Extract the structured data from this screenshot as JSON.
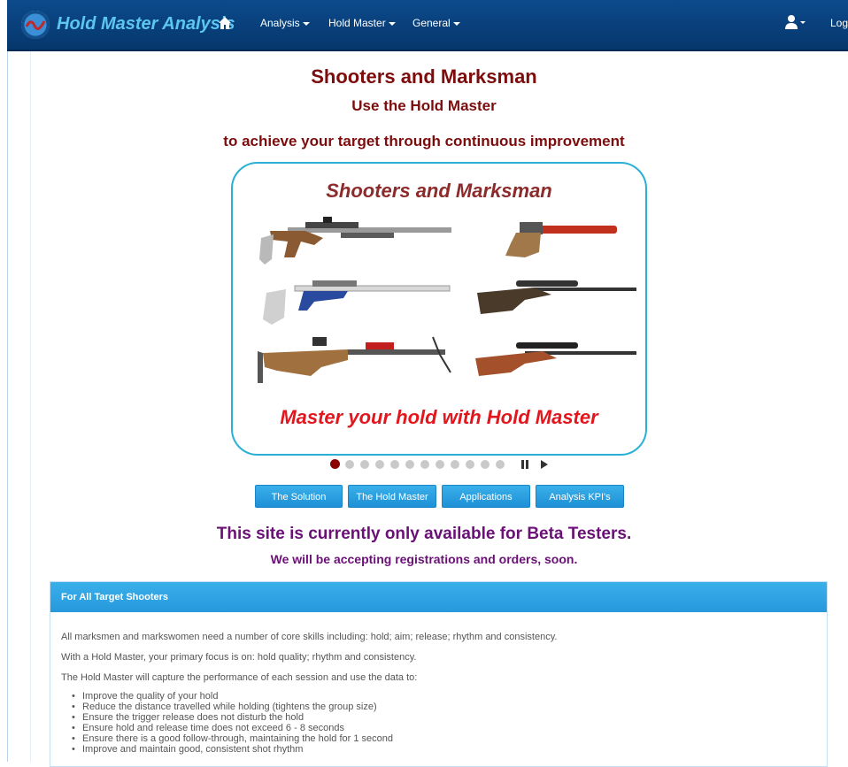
{
  "navbar": {
    "brand": "Hold Master Analysis",
    "items": [
      {
        "label": "Analysis"
      },
      {
        "label": "Hold Master"
      },
      {
        "label": "General"
      }
    ],
    "logout": "Log out"
  },
  "header": {
    "title": "Shooters and Marksman",
    "subtitle": "Use the Hold Master",
    "tagline": "to achieve your target through continuous improvement"
  },
  "carousel": {
    "slide_title": "Shooters and Marksman",
    "slide_caption": "Master your hold with Hold Master",
    "slide_count": 12,
    "active_index": 0
  },
  "buttons": [
    "The Solution",
    "The Hold Master",
    "Applications",
    "Analysis KPI's"
  ],
  "notice": {
    "headline": "This site is currently only available for Beta Testers.",
    "sub": "We will be accepting registrations and orders, soon."
  },
  "panel": {
    "title": "For All Target Shooters",
    "paragraphs": [
      "All marksmen and markswomen need a number of core skills including: hold; aim; release; rhythm and consistency.",
      "With a Hold Master, your primary focus is on: hold quality; rhythm and consistency.",
      "The Hold Master will capture the performance of each session and use the data to:"
    ],
    "bullets": [
      "Improve the quality of your hold",
      "Reduce the distance travelled while holding (tightens the group size)",
      "Ensure the trigger release does not disturb the hold",
      "Ensure hold and release time does not exceed 6 - 8 seconds",
      "Ensure there is a good follow-through, maintaining the hold for 1 second",
      "Improve and maintain good, consistent shot rhythm"
    ]
  },
  "colors": {
    "navbar": "#0c4a8c",
    "brand": "#5cc6f0",
    "headline": "#7d0c0c",
    "notice": "#6a1077",
    "button": "#1e90d6",
    "slide_border": "#2ab0d6",
    "slide_caption": "#e2161c"
  }
}
